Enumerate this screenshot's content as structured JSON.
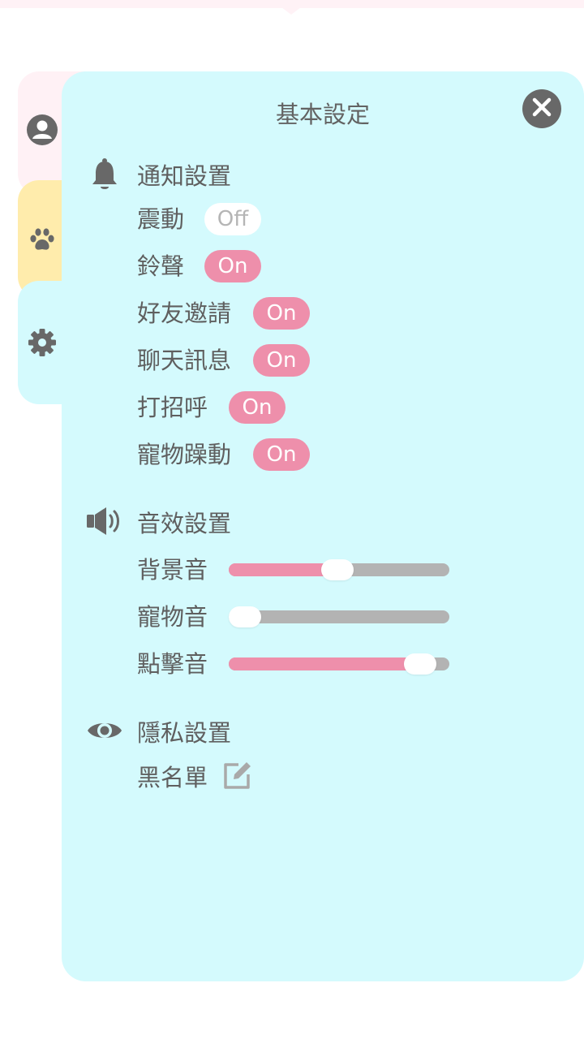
{
  "panel": {
    "title": "基本設定",
    "close_icon": "close-icon"
  },
  "tabs": [
    {
      "name": "profile",
      "icon": "user-icon",
      "color": "#fff1f5"
    },
    {
      "name": "pet",
      "icon": "paw-icon",
      "color": "#ffecac"
    },
    {
      "name": "settings",
      "icon": "gear-icon",
      "color": "#d4fafd"
    }
  ],
  "notifications": {
    "title": "通知設置",
    "icon": "bell-icon",
    "items": [
      {
        "label": "震動",
        "state": "Off"
      },
      {
        "label": "鈴聲",
        "state": "On"
      },
      {
        "label": "好友邀請",
        "state": "On"
      },
      {
        "label": "聊天訊息",
        "state": "On"
      },
      {
        "label": "打招呼",
        "state": "On"
      },
      {
        "label": "寵物躁動",
        "state": "On"
      }
    ]
  },
  "sound": {
    "title": "音效設置",
    "icon": "speaker-icon",
    "items": [
      {
        "label": "背景音",
        "level": 0.49
      },
      {
        "label": "寵物音",
        "level": 0.0
      },
      {
        "label": "點擊音",
        "level": 0.93
      }
    ]
  },
  "privacy": {
    "title": "隱私設置",
    "icon": "eye-icon",
    "blacklist_label": "黑名單",
    "blacklist_icon": "edit-icon"
  },
  "colors": {
    "accent_on": "#ee8fab",
    "panel_bg": "#d4fafd",
    "track": "#b3b3b3",
    "text": "#5f5f5f"
  }
}
